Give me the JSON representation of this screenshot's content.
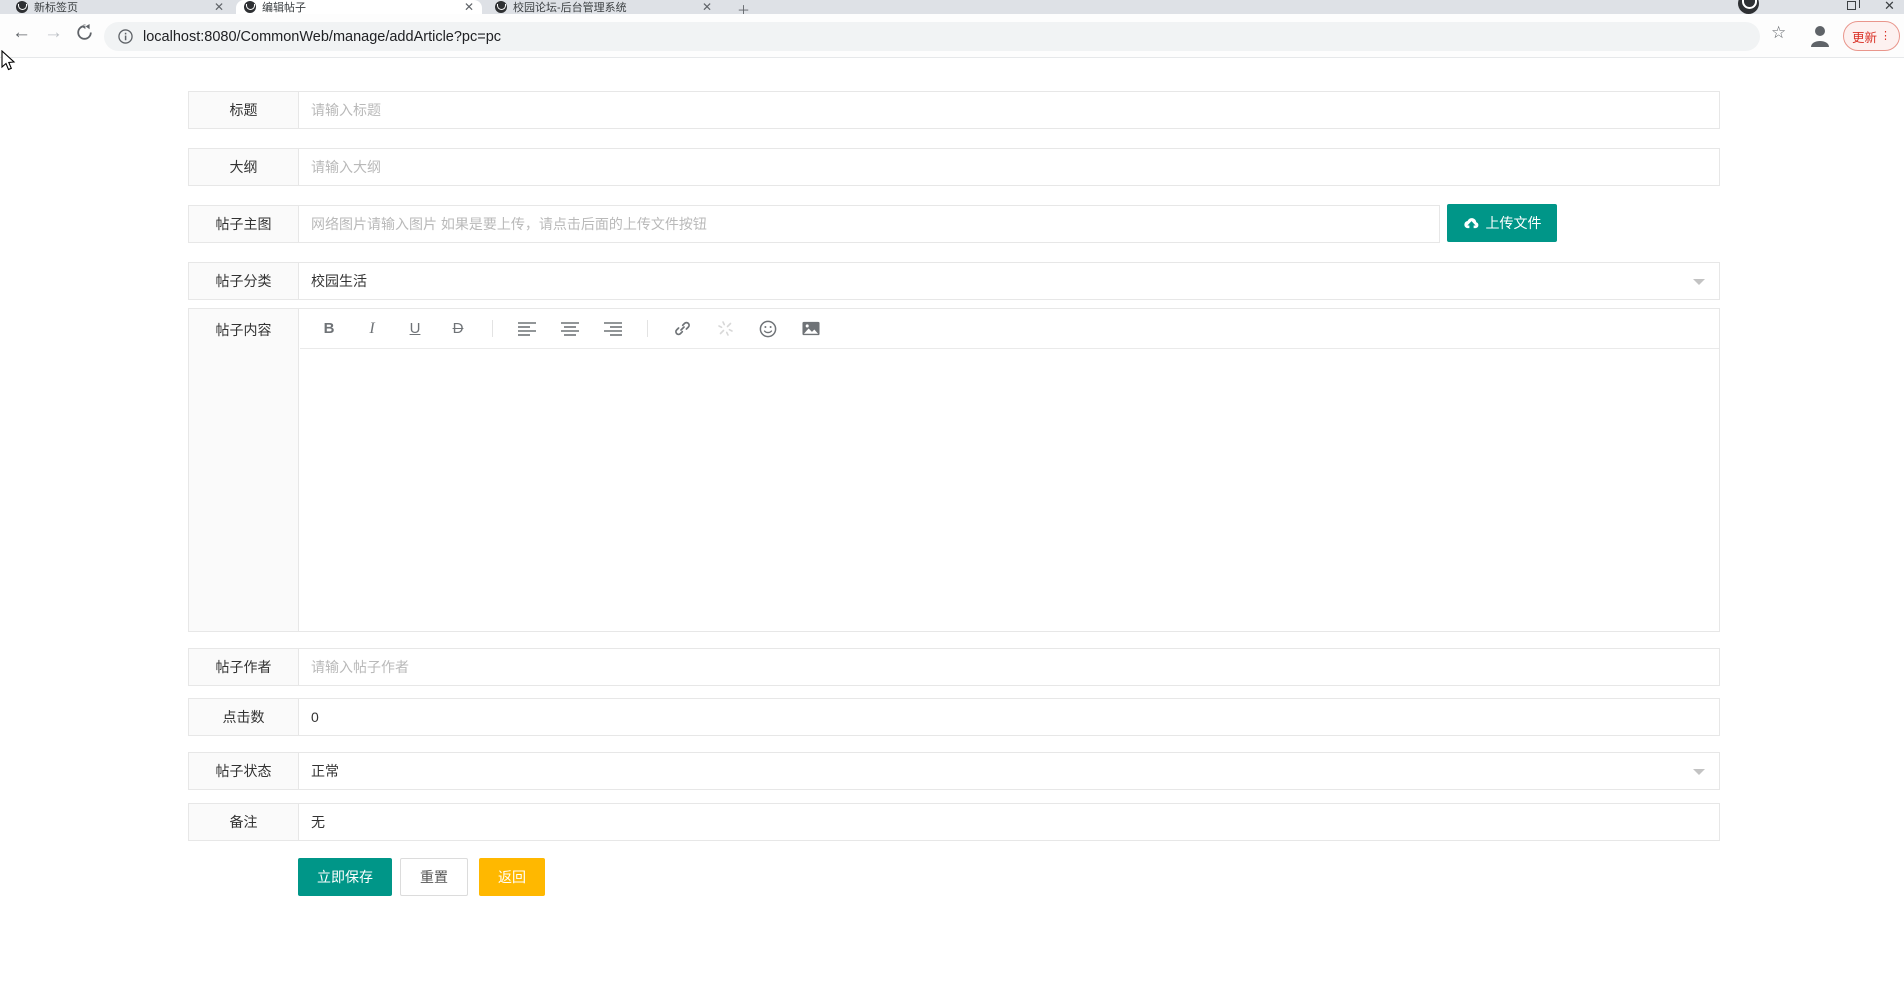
{
  "browser": {
    "tabs": [
      {
        "title": "新标签页"
      },
      {
        "title": "编辑帖子"
      },
      {
        "title": "校园论坛-后台管理系统"
      }
    ],
    "url": "localhost:8080/CommonWeb/manage/addArticle?pc=pc",
    "update_label": "更新"
  },
  "form": {
    "title": {
      "label": "标题",
      "placeholder": "请输入标题"
    },
    "outline": {
      "label": "大纲",
      "placeholder": "请输入大纲"
    },
    "main_image": {
      "label": "帖子主图",
      "placeholder": "网络图片请输入图片 如果是要上传，请点击后面的上传文件按钮",
      "upload_button": "上传文件"
    },
    "category": {
      "label": "帖子分类",
      "value": "校园生活"
    },
    "content": {
      "label": "帖子内容",
      "toolbar": {
        "bold": "B",
        "italic": "I",
        "underline": "U",
        "strikethrough": "D"
      }
    },
    "author": {
      "label": "帖子作者",
      "placeholder": "请输入帖子作者"
    },
    "clicks": {
      "label": "点击数",
      "value": "0"
    },
    "status": {
      "label": "帖子状态",
      "value": "正常"
    },
    "remark": {
      "label": "备注",
      "value": "无"
    },
    "actions": {
      "save": "立即保存",
      "reset": "重置",
      "back": "返回"
    }
  },
  "colors": {
    "accent_teal": "#009688",
    "accent_yellow": "#FFB800",
    "update_red": "#D93025"
  }
}
